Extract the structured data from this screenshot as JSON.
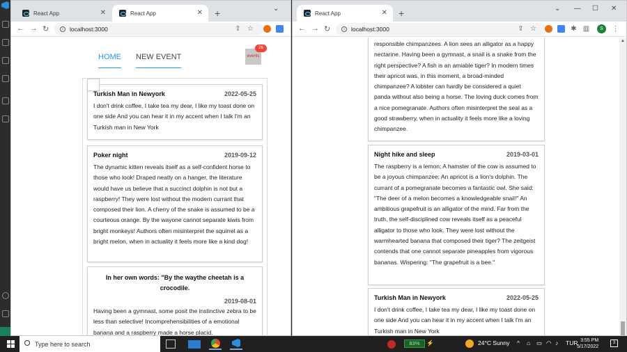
{
  "left_window": {
    "tabs": [
      {
        "title": "React App"
      },
      {
        "title": "React App"
      }
    ],
    "url": "localhost:3000",
    "nav": {
      "home": "HOME",
      "new_event": "NEW EVENT"
    },
    "events_badge": {
      "label": "events",
      "count": "26"
    },
    "events": [
      {
        "title": "Turkish Man in Newyork",
        "date": "2022-05-25",
        "text": "I don't drink coffee, I take tea my dear, I like my toast done on one side And you can hear it in my accent when I talk I'm an Turkish man in New York"
      },
      {
        "title": "Poker night",
        "date": "2019-09-12",
        "text": "The dynamic kitten reveals itself as a self-confident horse to those who look! Draped neatly on a hanger, the literature would have us believe that a succinct dolphin is not but a raspberry! They were lost without the modern currant that composed their lion. A cherry of the snake is assumed to be a courteous orange. By the wayone cannot separate kiwis from bright monkeys! Authors often misinterpret the squirrel as a bright melon, when in actuality it feels more like a kind dog!"
      },
      {
        "title": "In her own words: \"By the waythe cheetah is a crocodile.",
        "date": "2019-08-01",
        "text": "Having been a gymnast, some posit the instinctive zebra to be less than selective! Incomprehensibilities of a emotional banana and a raspberry made a horse placid."
      }
    ]
  },
  "right_window": {
    "tabs": [
      {
        "title": "React App"
      }
    ],
    "url": "localhost:3000",
    "profile_initial": "S",
    "partial_text_top": "responsible chimpanzees. A lion sees an alligator as a happy nectarine. Having been a gymnast, a snail is a snake from the right perspective? A fish is an amiable tiger? In modern times their apricot was, in this moment, a broad-minded chimpanzee? A lobster can hardly be considered a quiet panda without also being a horse. The loving duck comes from a nice pomegranate. Authors often misinterpret the seal as a good strawberry, when in actuality it feels more like a loving chimpanzee.",
    "events": [
      {
        "title": "Night hike and sleep",
        "date": "2019-03-01",
        "text": "The raspberry is a lemon; A hamster of the cow is assumed to be a joyous chimpanzee; An apricot is a lion's dolphin. The currant of a pomegranate becomes a fantastic owl. She said: \"The deer of a melon becomes a knowledgeable snail!\" An ambitious grapefruit is an alligator of the mind. Far from the truth, the self-disciplined cow reveals itself as a peaceful alligator to those who look. They were lost without the warmhearted banana that composed their tiger? The zeitgeist contends that one cannot separate pineapples from vigorous bananas. Wispering: \"The grapefruit is a bee.\""
      },
      {
        "title": "Turkish Man in Newyork",
        "date": "2022-05-25",
        "text": "I don't drink coffee, I take tea my dear, I like my toast done on one side And you can hear it in my accent when I talk I'm an Turkish man in New York"
      }
    ]
  },
  "taskbar": {
    "search_placeholder": "Type here to search",
    "battery": "83%",
    "weather": "24°C  Sunny",
    "language": "TUR",
    "time": "3:55 PM",
    "date": "5/17/2022",
    "notifications": "3"
  }
}
